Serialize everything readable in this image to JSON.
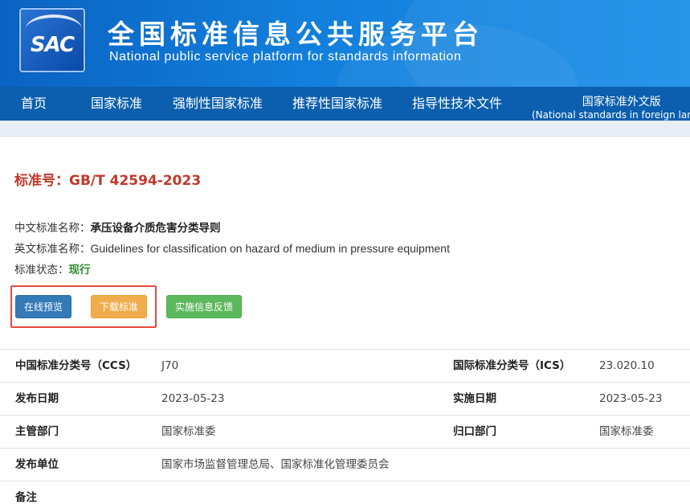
{
  "header": {
    "logo_text": "SAC",
    "title_cn": "全国标准信息公共服务平台",
    "title_en": "National public service platform  for standards information"
  },
  "nav": {
    "items": [
      {
        "label": "首页"
      },
      {
        "label": "国家标准"
      },
      {
        "label": "强制性国家标准"
      },
      {
        "label": "推荐性国家标准"
      },
      {
        "label": "指导性技术文件"
      }
    ],
    "foreign": {
      "line1": "国家标准外文版",
      "line2": "(National standards in foreign langua"
    }
  },
  "standard": {
    "number_label": "标准号：",
    "number": "GB/T 42594-2023",
    "cn_name_label": "中文标准名称：",
    "cn_name": "承压设备介质危害分类导则",
    "en_name_label": "英文标准名称：",
    "en_name": "Guidelines for classification on hazard of medium in pressure equipment",
    "status_label": "标准状态：",
    "status": "现行"
  },
  "buttons": {
    "preview": "在线预览",
    "download": "下载标准",
    "feedback": "实施信息反馈"
  },
  "details": {
    "ccs_label": "中国标准分类号（CCS）",
    "ccs_value": "J70",
    "ics_label": "国际标准分类号（ICS）",
    "ics_value": "23.020.10",
    "publish_date_label": "发布日期",
    "publish_date": "2023-05-23",
    "impl_date_label": "实施日期",
    "impl_date": "2023-05-23",
    "dept_label": "主管部门",
    "dept_value": "国家标准委",
    "owner_label": "归口部门",
    "owner_value": "国家标准委",
    "publisher_label": "发布单位",
    "publisher_value": "国家市场监督管理总局、国家标准化管理委员会",
    "remark_label": "备注"
  },
  "colors": {
    "header_blue": "#137fdc",
    "nav_blue": "#0b5fae",
    "std_red": "#c0392b",
    "status_green": "#2e8b2e",
    "btn_blue": "#337ab7",
    "btn_orange": "#f0ad4e",
    "btn_green": "#5cb85c",
    "highlight_red": "#e74c3c"
  }
}
